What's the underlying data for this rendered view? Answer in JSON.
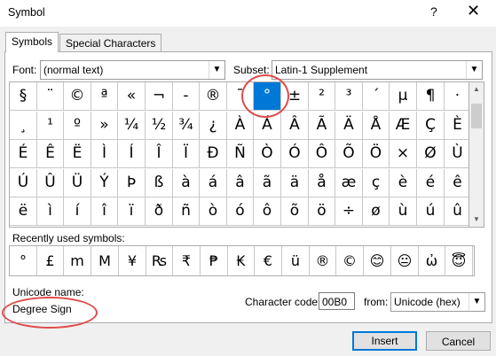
{
  "dialog": {
    "title": "Symbol",
    "help_glyph": "?",
    "close_glyph": "✕"
  },
  "tabs": [
    {
      "label": "Symbols",
      "active": true
    },
    {
      "label": "Special Characters",
      "active": false
    }
  ],
  "font": {
    "label": "Font:",
    "value": "(normal text)"
  },
  "subset": {
    "label": "Subset:",
    "value": "Latin-1 Supplement"
  },
  "symbol_rows": [
    [
      "§",
      "¨",
      "©",
      "ª",
      "«",
      "¬",
      "-",
      "®",
      "¯",
      "°",
      "±",
      "²",
      "³",
      "´",
      "µ",
      "¶",
      "·"
    ],
    [
      "¸",
      "¹",
      "º",
      "»",
      "¼",
      "½",
      "¾",
      "¿",
      "À",
      "Á",
      "Â",
      "Ã",
      "Ä",
      "Å",
      "Æ",
      "Ç",
      "È"
    ],
    [
      "É",
      "Ê",
      "Ë",
      "Ì",
      "Í",
      "Î",
      "Ï",
      "Đ",
      "Ñ",
      "Ò",
      "Ó",
      "Ô",
      "Õ",
      "Ö",
      "×",
      "Ø",
      "Ù"
    ],
    [
      "Ú",
      "Û",
      "Ü",
      "Ý",
      "Þ",
      "ß",
      "à",
      "á",
      "â",
      "ã",
      "ä",
      "å",
      "æ",
      "ç",
      "è",
      "é",
      "ê"
    ],
    [
      "ë",
      "ì",
      "í",
      "î",
      "ï",
      "ð",
      "ñ",
      "ò",
      "ó",
      "ô",
      "õ",
      "ö",
      "÷",
      "ø",
      "ù",
      "ú",
      "û"
    ]
  ],
  "selected_symbol": "°",
  "recent": {
    "label": "Recently used symbols:",
    "symbols": [
      "°",
      "£",
      "m",
      "M",
      "¥",
      "₨",
      "₹",
      "₱",
      "₭",
      "€",
      "ü",
      "®",
      "©",
      "😊",
      "😐",
      "ὠ",
      "😇"
    ]
  },
  "unicode_name": {
    "label": "Unicode name:",
    "value": "Degree Sign"
  },
  "character_code": {
    "label": "Character code:",
    "value": "00B0"
  },
  "from": {
    "label": "from:",
    "value": "Unicode (hex)"
  },
  "buttons": {
    "insert": "Insert",
    "cancel": "Cancel"
  },
  "colors": {
    "selection": "#0078d7",
    "annotation": "#e04a4a"
  }
}
